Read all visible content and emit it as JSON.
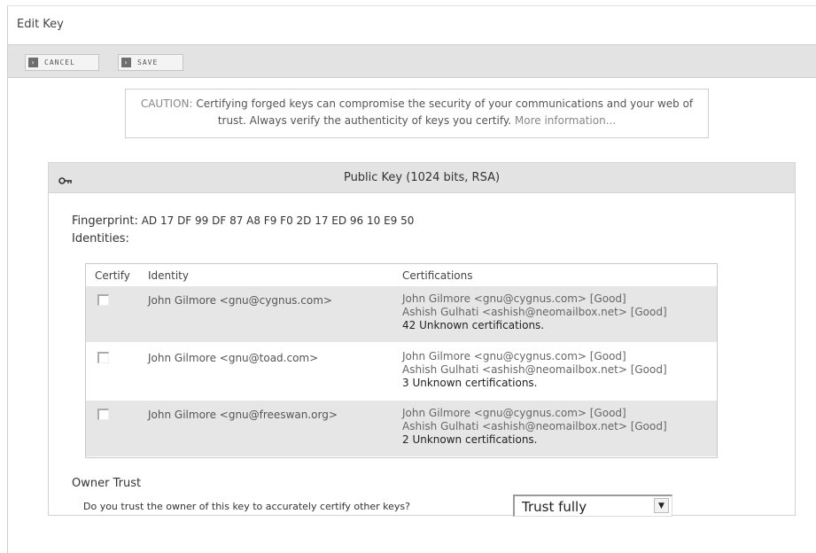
{
  "window": {
    "title": "Edit Key"
  },
  "toolbar": {
    "cancel_label": "CANCEL",
    "save_label": "SAVE",
    "button_glyph": "›"
  },
  "caution": {
    "prefix": "CAUTION:",
    "text": " Certifying forged keys can compromise the security of your communications and your web of trust. Always verify the authenticity of keys you certify. ",
    "link": "More information..."
  },
  "key": {
    "title": "Public Key (1024 bits, RSA)",
    "icon": "key-icon",
    "fingerprint_label": "Fingerprint:",
    "fingerprint": " AD 17 DF 99 DF 87 A8 F9 F0 2D 17 ED 96 10 E9 50",
    "identities_label": "Identities:"
  },
  "identities": {
    "headers": {
      "certify": "Certify",
      "identity": "Identity",
      "certifications": "Certifications"
    },
    "rows": [
      {
        "identity": "John Gilmore <gnu@cygnus.com>",
        "cert1": "John Gilmore <gnu@cygnus.com> [Good]",
        "cert2": "Ashish Gulhati <ashish@neomailbox.net> [Good]",
        "unknown": "42 Unknown certifications."
      },
      {
        "identity": "John Gilmore <gnu@toad.com>",
        "cert1": "John Gilmore <gnu@cygnus.com> [Good]",
        "cert2": "Ashish Gulhati <ashish@neomailbox.net> [Good]",
        "unknown": "3 Unknown certifications."
      },
      {
        "identity": "John Gilmore <gnu@freeswan.org>",
        "cert1": "John Gilmore <gnu@cygnus.com> [Good]",
        "cert2": "Ashish Gulhati <ashish@neomailbox.net> [Good]",
        "unknown": "2 Unknown certifications."
      }
    ]
  },
  "owner_trust": {
    "heading": "Owner Trust",
    "question": "Do you trust the owner of this key to accurately certify other keys?",
    "selected": "Trust fully",
    "arrow": "▼"
  },
  "colors": {
    "toolbar_bg": "#e3e3e3",
    "row_shade": "#e6e6e6",
    "border": "#cfcfcf"
  }
}
